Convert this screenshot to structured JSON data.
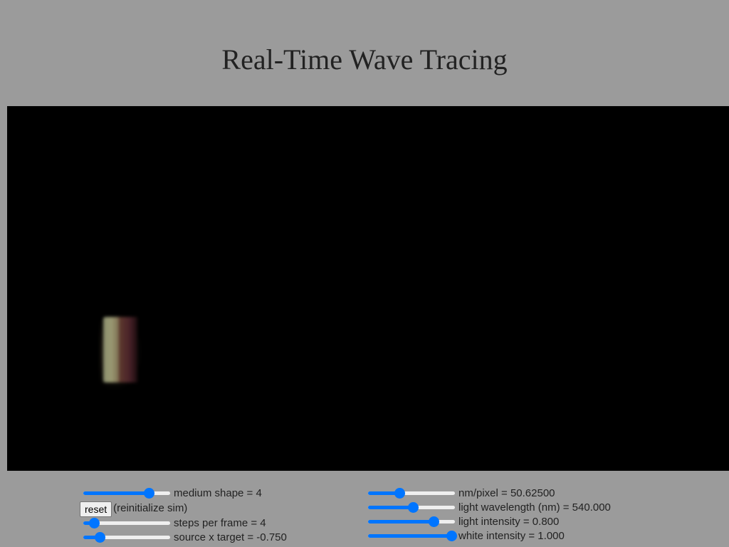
{
  "page": {
    "title": "Real-Time Wave Tracing"
  },
  "controls_left": {
    "medium_shape": {
      "label": "medium shape = 4",
      "value_fraction": 0.78
    },
    "reset": {
      "button_label": "reset",
      "note": "(reinitialize sim)"
    },
    "steps_per_frame": {
      "label": "steps per frame = 4",
      "value_fraction": 0.09
    },
    "source_x_target": {
      "label": "source x target = -0.750",
      "value_fraction": 0.16
    }
  },
  "controls_right": {
    "nm_per_pixel": {
      "label": "nm/pixel = 50.62500",
      "value_fraction": 0.35
    },
    "light_wavelength": {
      "label": "light wavelength (nm) = 540.000",
      "value_fraction": 0.52
    },
    "light_intensity": {
      "label": "light intensity = 0.800",
      "value_fraction": 0.78
    },
    "white_intensity": {
      "label": "white intensity = 1.000",
      "value_fraction": 1.0
    }
  },
  "colors": {
    "background": "#9b9b9b",
    "canvas": "#000000",
    "slider_accent": "#0075ff"
  }
}
